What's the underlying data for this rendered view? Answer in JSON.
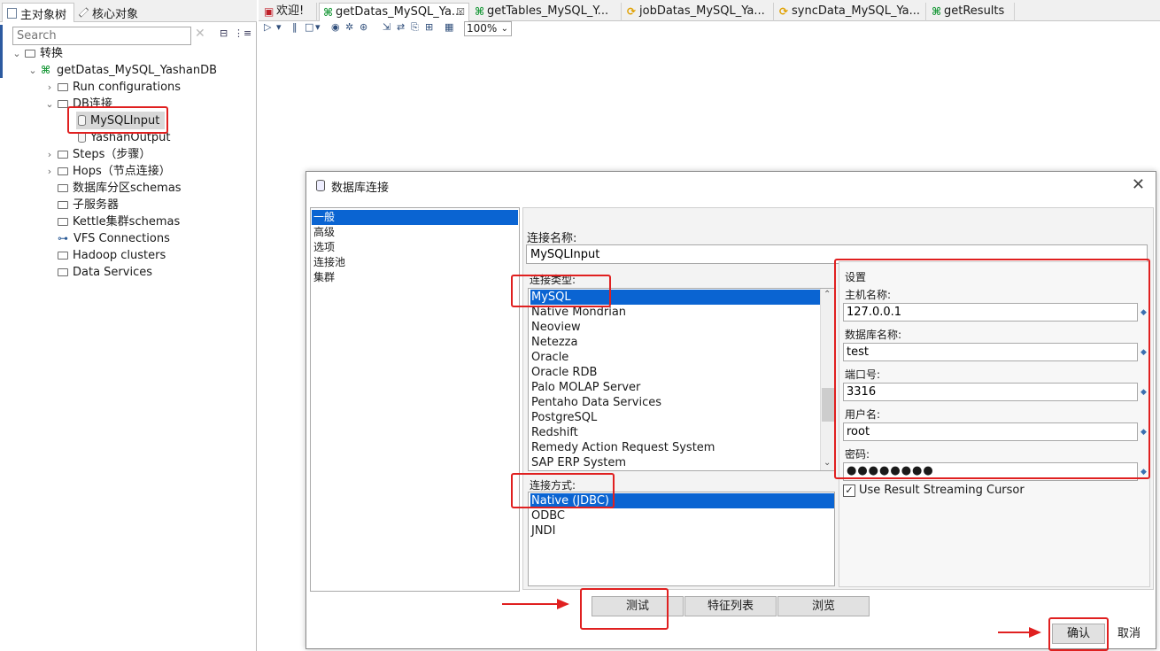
{
  "left_panel": {
    "tabs": [
      "主对象树",
      "核心对象"
    ],
    "search_placeholder": "Search",
    "search_clear": "✕",
    "tool_icons": [
      "collapse-all-icon",
      "expand-icon"
    ],
    "tree": {
      "root": "转换",
      "transformation": "getDatas_MySQL_YashanDB",
      "items": [
        "Run configurations",
        "DB连接",
        "MySQLInput",
        "YashanOutput",
        "Steps（步骤）",
        "Hops（节点连接）",
        "数据库分区schemas",
        "子服务器",
        "Kettle集群schemas",
        "VFS Connections",
        "Hadoop clusters",
        "Data Services"
      ]
    }
  },
  "editor": {
    "tabs": [
      "欢迎!",
      "getDatas_MySQL_Ya...",
      "getTables_MySQL_Y...",
      "jobDatas_MySQL_Ya...",
      "syncData_MySQL_Ya...",
      "getResults"
    ],
    "active_tab_close": "☒",
    "zoom": "100%"
  },
  "dialog": {
    "title": "数据库连接",
    "close": "✕",
    "categories": [
      "一般",
      "高级",
      "选项",
      "连接池",
      "集群"
    ],
    "connection_name_label": "连接名称:",
    "connection_name": "MySQLInput",
    "connection_type_label": "连接类型:",
    "connection_types": [
      "MySQL",
      "Native Mondrian",
      "Neoview",
      "Netezza",
      "Oracle",
      "Oracle RDB",
      "Palo MOLAP Server",
      "Pentaho Data Services",
      "PostgreSQL",
      "Redshift",
      "Remedy Action Request System",
      "SAP ERP System"
    ],
    "access_label": "连接方式:",
    "access_methods": [
      "Native (JDBC)",
      "ODBC",
      "JNDI"
    ],
    "settings": {
      "title": "设置",
      "host_label": "主机名称:",
      "host": "127.0.0.1",
      "db_label": "数据库名称:",
      "db": "test",
      "port_label": "端口号:",
      "port": "3316",
      "user_label": "用户名:",
      "user": "root",
      "password_label": "密码:",
      "password": "●●●●●●●●",
      "streaming_label": "Use Result Streaming Cursor",
      "streaming_checked": "✓"
    },
    "buttons": {
      "test": "测试",
      "features": "特征列表",
      "browse": "浏览",
      "ok": "确认",
      "cancel": "取消"
    }
  },
  "colors": {
    "selection": "#0a64d2",
    "annotation_red": "#e02020",
    "kettle_green": "#1d9a3c"
  }
}
